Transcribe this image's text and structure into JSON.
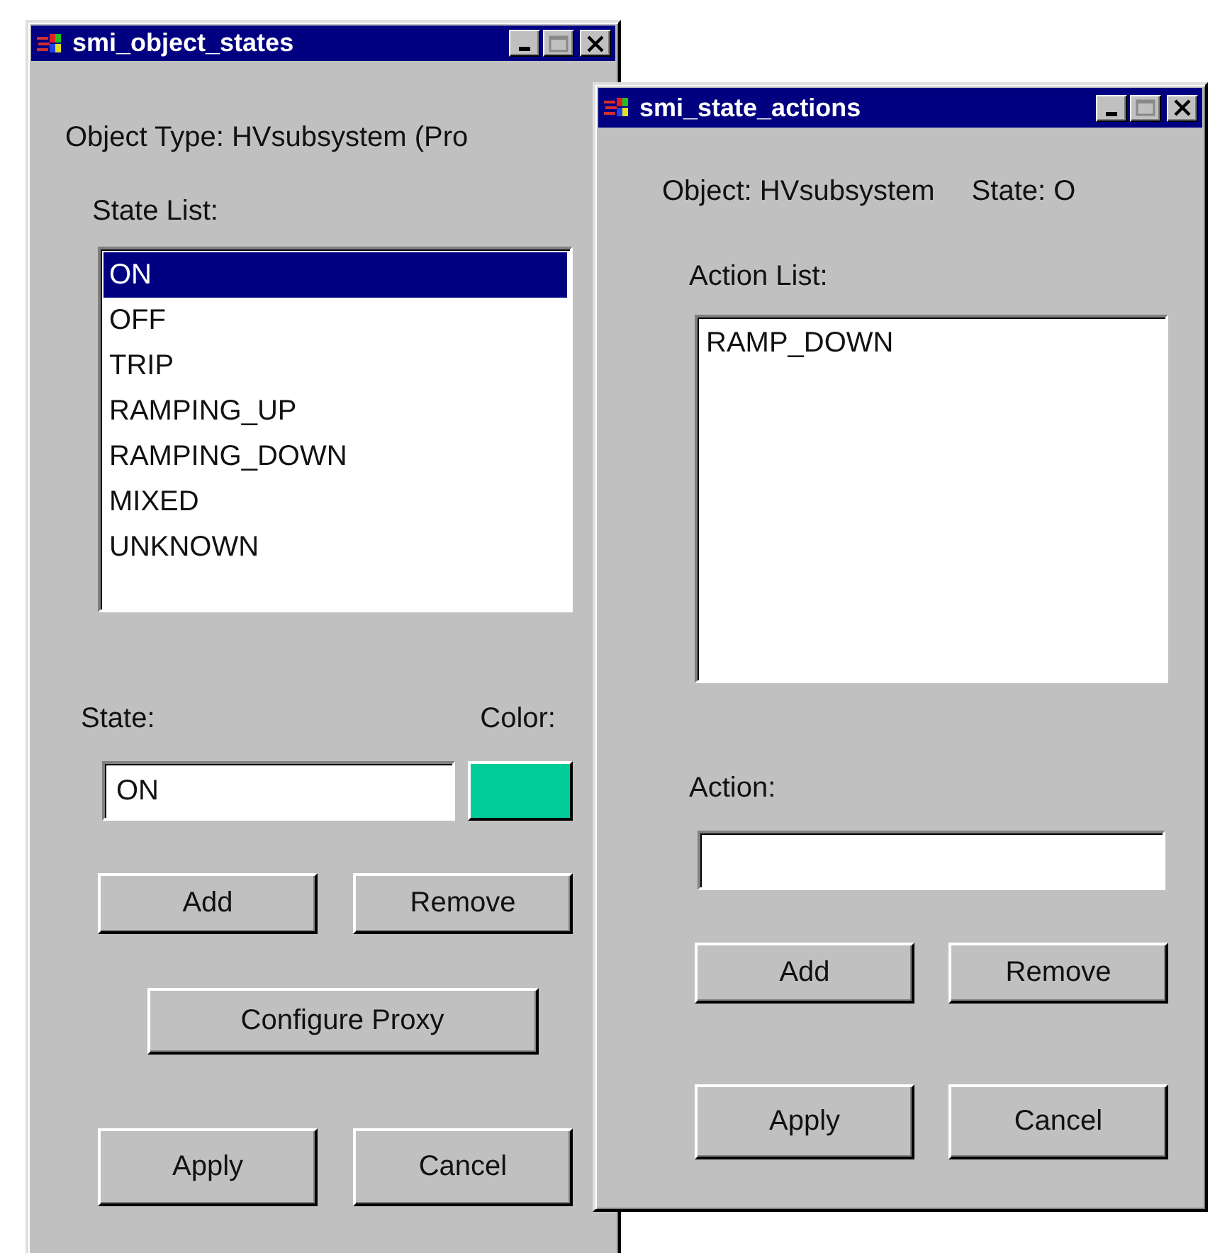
{
  "object_states_window": {
    "title": "smi_object_states",
    "object_type": "Object Type: HVsubsystem (Pro",
    "list_label": "State List:",
    "states": [
      {
        "label": "ON",
        "selected": true
      },
      {
        "label": "OFF",
        "selected": false
      },
      {
        "label": "TRIP",
        "selected": false
      },
      {
        "label": "RAMPING_UP",
        "selected": false
      },
      {
        "label": "RAMPING_DOWN",
        "selected": false
      },
      {
        "label": "MIXED",
        "selected": false
      },
      {
        "label": "UNKNOWN",
        "selected": false
      }
    ],
    "state_label": "State:",
    "state_value": "ON",
    "color_label": "Color:",
    "color": "#00cc99",
    "button_rows": [
      [
        "Add",
        "Remove"
      ],
      [
        "Configure Proxy"
      ],
      [
        "Apply",
        "Cancel"
      ]
    ]
  },
  "state_actions_window": {
    "title": "smi_state_actions",
    "object": "Object: HVsubsystem",
    "state": "State: O",
    "list_label": "Action List:",
    "actions": [
      {
        "label": "RAMP_DOWN",
        "selected": false
      }
    ],
    "action_label": "Action:",
    "button_rows": [
      [
        "Add",
        "Remove"
      ],
      [
        "Apply",
        "Cancel"
      ]
    ]
  }
}
